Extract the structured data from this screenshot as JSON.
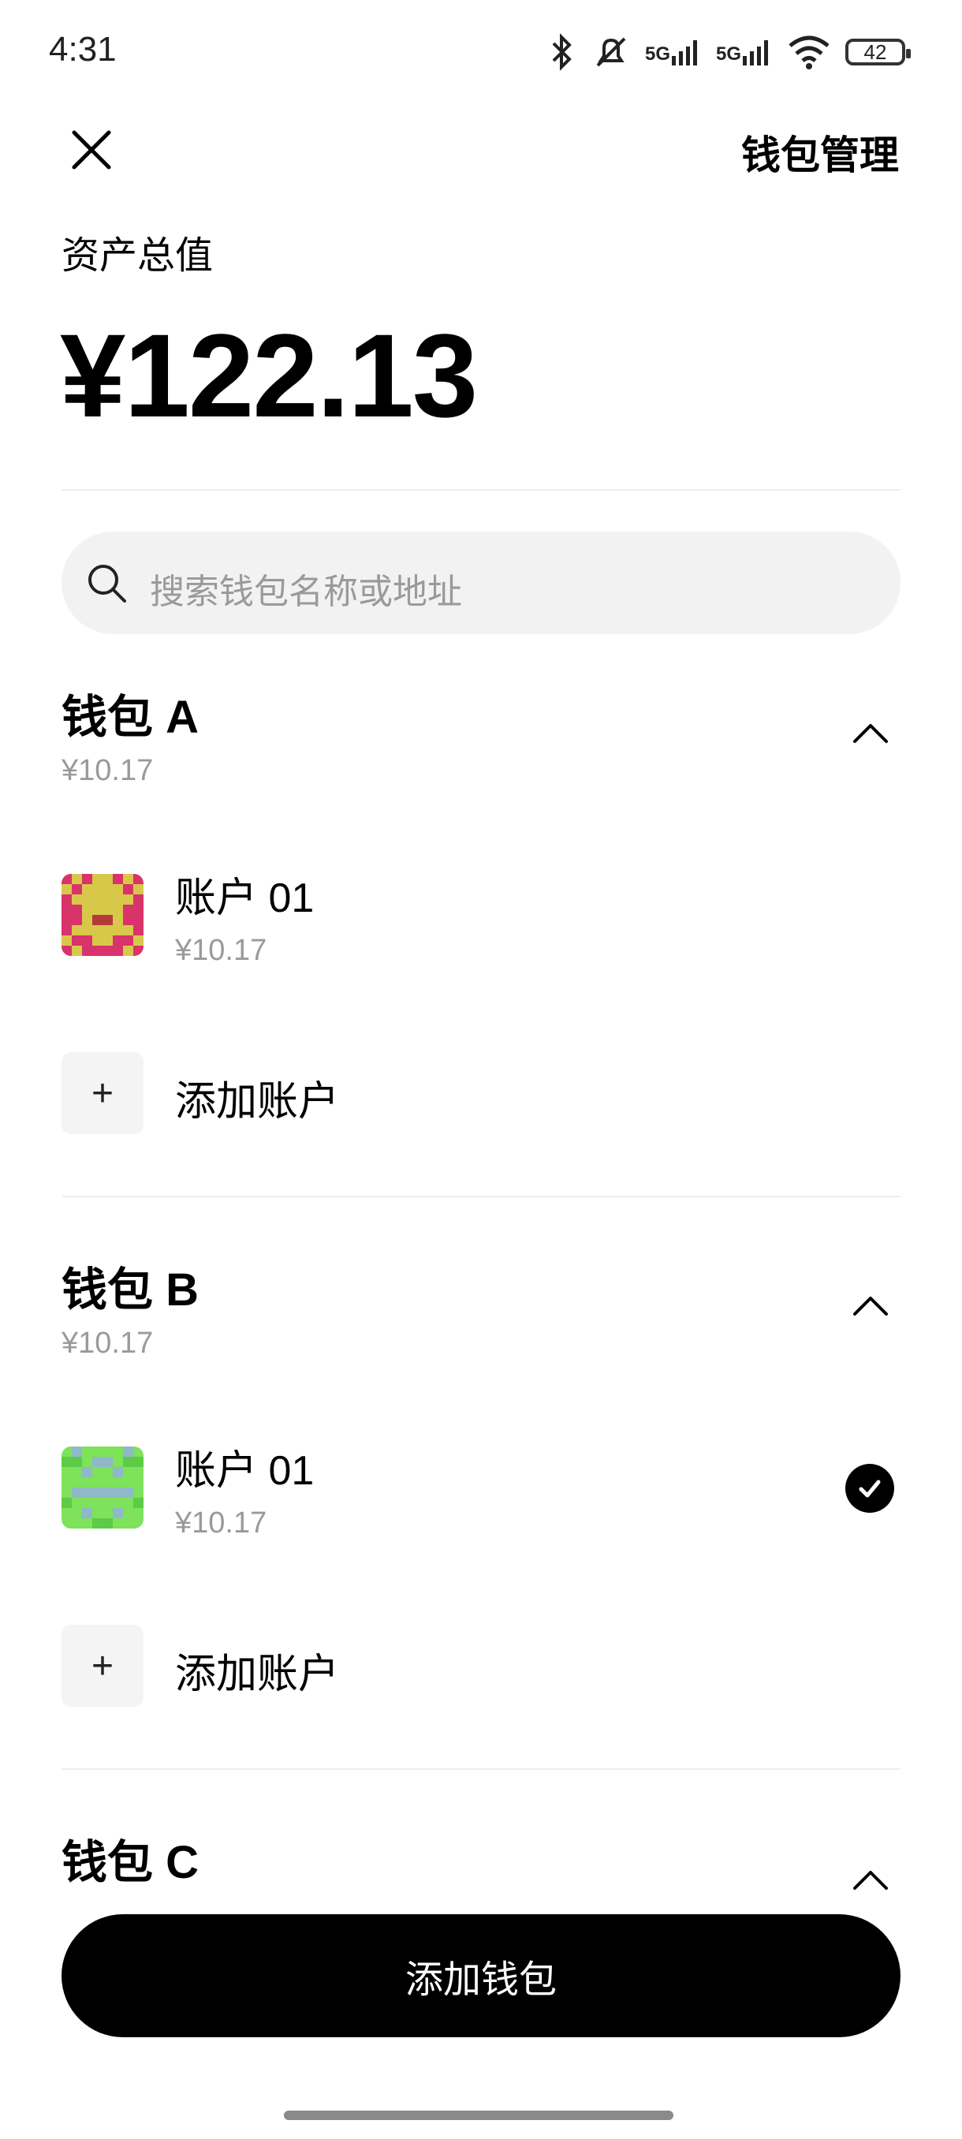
{
  "status_bar": {
    "time": "4:31",
    "battery": "42",
    "network_1": "5G",
    "network_2": "5G"
  },
  "header": {
    "title": "钱包管理"
  },
  "total": {
    "label": "资产总值",
    "value": "¥122.13"
  },
  "search": {
    "placeholder": "搜索钱包名称或地址"
  },
  "wallets": [
    {
      "name": "钱包 A",
      "amount": "¥10.17",
      "accounts": [
        {
          "name": "账户 01",
          "amount": "¥10.17",
          "selected": false
        }
      ],
      "add_account_label": "添加账户"
    },
    {
      "name": "钱包 B",
      "amount": "¥10.17",
      "accounts": [
        {
          "name": "账户 01",
          "amount": "¥10.17",
          "selected": true
        }
      ],
      "add_account_label": "添加账户"
    },
    {
      "name": "钱包 C"
    }
  ],
  "bottom_button": {
    "label": "添加钱包"
  },
  "icons": {
    "close": "close-icon",
    "search": "search-icon",
    "chevron": "chevron-up-icon",
    "add": "plus-icon",
    "check": "check-circle-icon",
    "bluetooth": "bluetooth-icon",
    "mute": "bell-off-icon",
    "wifi": "wifi-icon",
    "battery": "battery-icon"
  },
  "colors": {
    "accent": "#000000",
    "muted_text": "#9a9a9a",
    "search_bg": "#f2f2f2"
  }
}
